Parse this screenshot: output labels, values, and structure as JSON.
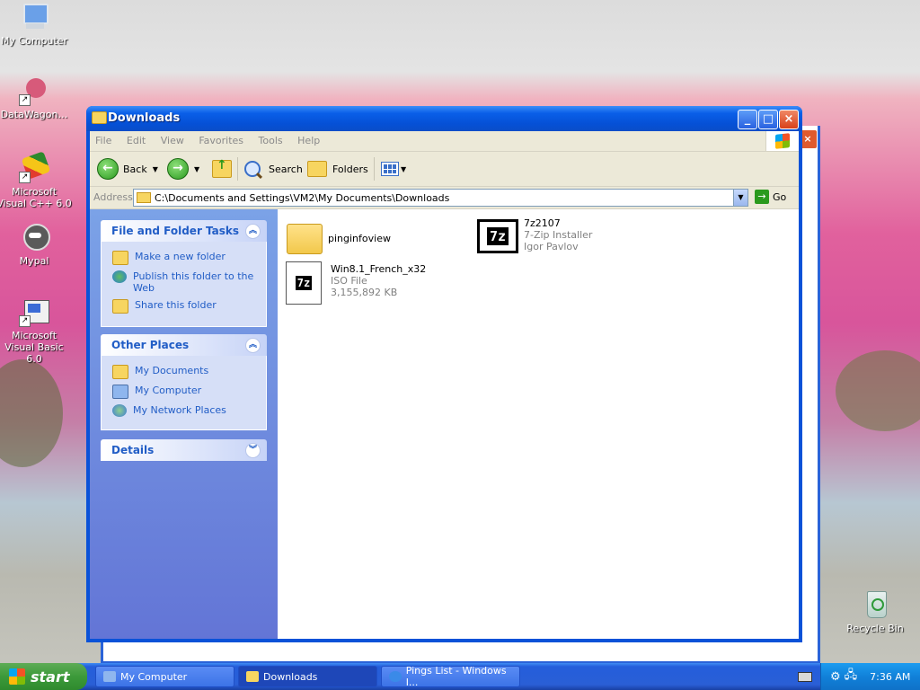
{
  "desktop": {
    "icons": [
      {
        "label": "My Computer"
      },
      {
        "label": "DataWagon…"
      },
      {
        "label": "Microsoft Visual C++ 6.0"
      },
      {
        "label": "Mypal"
      },
      {
        "label": "Microsoft Visual Basic 6.0"
      },
      {
        "label": "Recycle Bin"
      }
    ]
  },
  "window": {
    "title": "Downloads",
    "menu": [
      "File",
      "Edit",
      "View",
      "Favorites",
      "Tools",
      "Help"
    ],
    "toolbar": {
      "back": "Back",
      "search": "Search",
      "folders": "Folders"
    },
    "address": {
      "label": "Address",
      "value": "C:\\Documents and Settings\\VM2\\My Documents\\Downloads",
      "go": "Go"
    },
    "tasks": {
      "file_folder": {
        "title": "File and Folder Tasks",
        "items": [
          "Make a new folder",
          "Publish this folder to the Web",
          "Share this folder"
        ]
      },
      "other_places": {
        "title": "Other Places",
        "items": [
          "My Documents",
          "My Computer",
          "My Network Places"
        ]
      },
      "details": {
        "title": "Details"
      }
    },
    "files": [
      {
        "name": "pinginfoview",
        "type": "",
        "info": ""
      },
      {
        "name": "7z2107",
        "type": "7-Zip Installer",
        "info": "Igor Pavlov"
      },
      {
        "name": "Win8.1_French_x32",
        "type": "ISO File",
        "info": "3,155,892 KB"
      }
    ],
    "icon_text": "7z"
  },
  "taskbar": {
    "start": "start",
    "buttons": [
      "My Computer",
      "Downloads",
      "Pings List - Windows I..."
    ],
    "clock": "7:36 AM"
  },
  "colors": {
    "title_blue": "#0a52d8",
    "task_link": "#215dc6",
    "start_green": "#3c9a3a"
  }
}
